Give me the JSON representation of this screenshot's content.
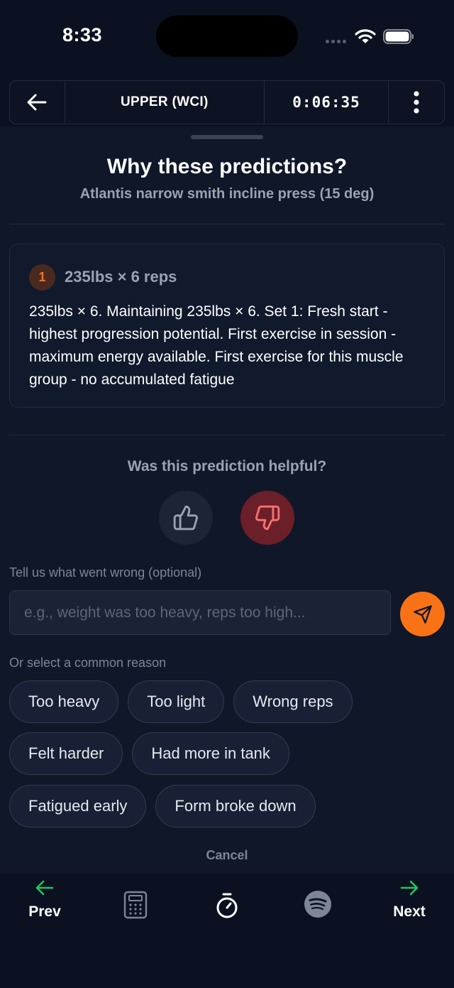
{
  "status_bar": {
    "time": "8:33"
  },
  "header": {
    "session_title": "UPPER (WCI)",
    "timer": "0:06:35"
  },
  "sheet": {
    "title": "Why these predictions?",
    "exercise": "Atlantis narrow smith incline press (15 deg)",
    "prediction": {
      "set_number": "1",
      "heading": "235lbs × 6 reps",
      "explanation": "235lbs × 6. Maintaining 235lbs × 6. Set 1: Fresh start - highest progression potential. First exercise in session - maximum energy available. First exercise for this muscle group - no accumulated fatigue"
    },
    "helpful_question": "Was this prediction helpful?",
    "feedback_label": "Tell us what went wrong (optional)",
    "feedback_placeholder": "e.g., weight was too heavy, reps too high...",
    "feedback_value": "",
    "reason_label": "Or select a common reason",
    "reasons": [
      "Too heavy",
      "Too light",
      "Wrong reps",
      "Felt harder",
      "Had more in tank",
      "Fatigued early",
      "Form broke down"
    ],
    "cancel_label": "Cancel"
  },
  "bottom_nav": {
    "prev_label": "Prev",
    "next_label": "Next"
  },
  "colors": {
    "background": "#0b1120",
    "accent": "#f97316",
    "nav_arrow": "#22c55e",
    "thumb_down_bg": "#6b1f28",
    "thumb_down_icon": "#f87171"
  },
  "icons": [
    "back-arrow-icon",
    "more-vertical-icon",
    "thumbs-up-icon",
    "thumbs-down-icon",
    "send-icon",
    "arrow-left-icon",
    "calculator-icon",
    "stopwatch-icon",
    "spotify-icon",
    "arrow-right-icon"
  ]
}
